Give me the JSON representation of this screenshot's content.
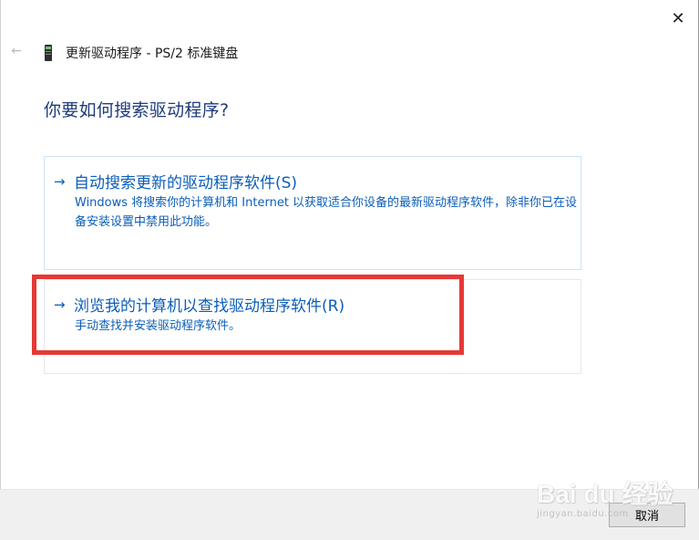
{
  "window": {
    "title": "更新驱动程序 - PS/2 标准键盘",
    "close_glyph": "✕",
    "back_glyph": "←"
  },
  "page": {
    "heading": "你要如何搜索驱动程序?"
  },
  "options": [
    {
      "arrow": "→",
      "title": "自动搜索更新的驱动程序软件(S)",
      "description": "Windows 将搜索你的计算机和 Internet 以获取适合你设备的最新驱动程序软件，除非你已在设备安装设置中禁用此功能。"
    },
    {
      "arrow": "→",
      "title": "浏览我的计算机以查找驱动程序软件(R)",
      "description": "手动查找并安装驱动程序软件。",
      "highlighted": true
    }
  ],
  "footer": {
    "cancel_label": "取消"
  },
  "watermark": {
    "main": "Bai du 经验",
    "sub": "jingyan.baidu.com"
  },
  "colors": {
    "link_blue": "#0b5eb8",
    "heading_blue": "#1f3b7a",
    "highlight_red": "#e53935"
  }
}
